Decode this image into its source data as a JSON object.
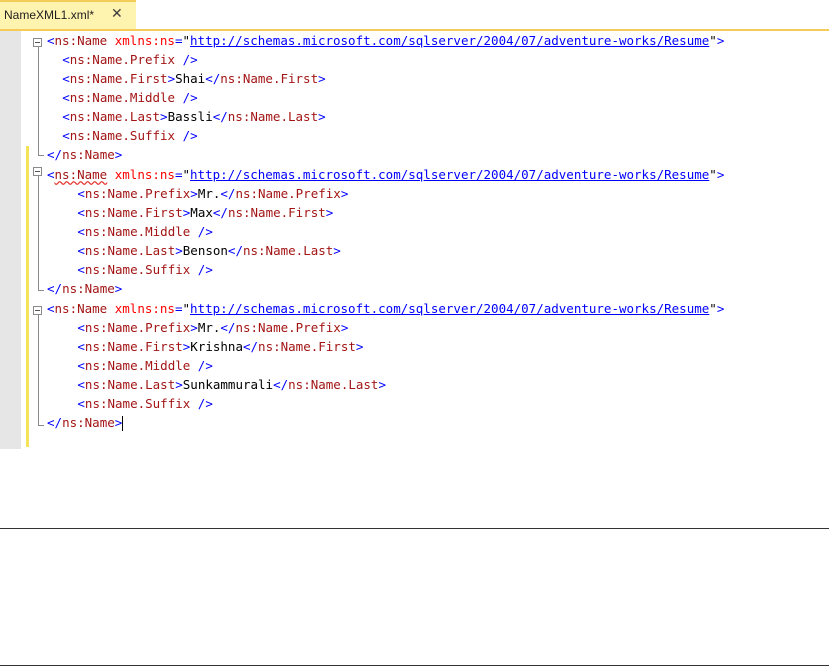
{
  "tab": {
    "title": "NameXML1.xml*",
    "close_glyph": "✕"
  },
  "lines": [
    {
      "indent": 0,
      "parts": [
        [
          "d",
          "<"
        ],
        [
          "t",
          "ns:Name"
        ],
        [
          "a",
          " xmlns:ns"
        ],
        [
          "d",
          "="
        ],
        [
          "q",
          "\""
        ],
        [
          "u",
          "http://schemas.microsoft.com/sqlserver/2004/07/adventure-works/Resume"
        ],
        [
          "q",
          "\""
        ],
        [
          "d",
          ">"
        ]
      ]
    },
    {
      "indent": 2,
      "parts": [
        [
          "d",
          "<"
        ],
        [
          "t",
          "ns:Name.Prefix"
        ],
        [
          "d",
          " />"
        ]
      ]
    },
    {
      "indent": 2,
      "parts": [
        [
          "d",
          "<"
        ],
        [
          "t",
          "ns:Name.First"
        ],
        [
          "d",
          ">"
        ],
        [
          "x",
          "Shai"
        ],
        [
          "d",
          "</"
        ],
        [
          "t",
          "ns:Name.First"
        ],
        [
          "d",
          ">"
        ]
      ]
    },
    {
      "indent": 2,
      "parts": [
        [
          "d",
          "<"
        ],
        [
          "t",
          "ns:Name.Middle"
        ],
        [
          "d",
          " />"
        ]
      ]
    },
    {
      "indent": 2,
      "parts": [
        [
          "d",
          "<"
        ],
        [
          "t",
          "ns:Name.Last"
        ],
        [
          "d",
          ">"
        ],
        [
          "x",
          "Bassli"
        ],
        [
          "d",
          "</"
        ],
        [
          "t",
          "ns:Name.Last"
        ],
        [
          "d",
          ">"
        ]
      ]
    },
    {
      "indent": 2,
      "parts": [
        [
          "d",
          "<"
        ],
        [
          "t",
          "ns:Name.Suffix"
        ],
        [
          "d",
          " />"
        ]
      ]
    },
    {
      "indent": 0,
      "parts": [
        [
          "d",
          "</"
        ],
        [
          "t",
          "ns:Name"
        ],
        [
          "d",
          ">"
        ]
      ]
    },
    {
      "indent": 0,
      "parts": [
        [
          "d",
          "<"
        ],
        [
          "s",
          "ns:Name"
        ],
        [
          "a",
          " xmlns:ns"
        ],
        [
          "d",
          "="
        ],
        [
          "q",
          "\""
        ],
        [
          "u",
          "http://schemas.microsoft.com/sqlserver/2004/07/adventure-works/Resume"
        ],
        [
          "q",
          "\""
        ],
        [
          "d",
          ">"
        ]
      ]
    },
    {
      "indent": 4,
      "parts": [
        [
          "d",
          "<"
        ],
        [
          "t",
          "ns:Name.Prefix"
        ],
        [
          "d",
          ">"
        ],
        [
          "x",
          "Mr."
        ],
        [
          "d",
          "</"
        ],
        [
          "t",
          "ns:Name.Prefix"
        ],
        [
          "d",
          ">"
        ]
      ]
    },
    {
      "indent": 4,
      "parts": [
        [
          "d",
          "<"
        ],
        [
          "t",
          "ns:Name.First"
        ],
        [
          "d",
          ">"
        ],
        [
          "x",
          "Max"
        ],
        [
          "d",
          "</"
        ],
        [
          "t",
          "ns:Name.First"
        ],
        [
          "d",
          ">"
        ]
      ]
    },
    {
      "indent": 4,
      "parts": [
        [
          "d",
          "<"
        ],
        [
          "t",
          "ns:Name.Middle"
        ],
        [
          "d",
          " />"
        ]
      ]
    },
    {
      "indent": 4,
      "parts": [
        [
          "d",
          "<"
        ],
        [
          "t",
          "ns:Name.Last"
        ],
        [
          "d",
          ">"
        ],
        [
          "x",
          "Benson"
        ],
        [
          "d",
          "</"
        ],
        [
          "t",
          "ns:Name.Last"
        ],
        [
          "d",
          ">"
        ]
      ]
    },
    {
      "indent": 4,
      "parts": [
        [
          "d",
          "<"
        ],
        [
          "t",
          "ns:Name.Suffix"
        ],
        [
          "d",
          " />"
        ]
      ]
    },
    {
      "indent": 0,
      "parts": [
        [
          "d",
          "</"
        ],
        [
          "t",
          "ns:Name"
        ],
        [
          "d",
          ">"
        ]
      ]
    },
    {
      "indent": 0,
      "parts": [
        [
          "d",
          "<"
        ],
        [
          "t",
          "ns:Name"
        ],
        [
          "a",
          " xmlns:ns"
        ],
        [
          "d",
          "="
        ],
        [
          "q",
          "\""
        ],
        [
          "u",
          "http://schemas.microsoft.com/sqlserver/2004/07/adventure-works/Resume"
        ],
        [
          "q",
          "\""
        ],
        [
          "d",
          ">"
        ]
      ]
    },
    {
      "indent": 4,
      "parts": [
        [
          "d",
          "<"
        ],
        [
          "t",
          "ns:Name.Prefix"
        ],
        [
          "d",
          ">"
        ],
        [
          "x",
          "Mr."
        ],
        [
          "d",
          "</"
        ],
        [
          "t",
          "ns:Name.Prefix"
        ],
        [
          "d",
          ">"
        ]
      ]
    },
    {
      "indent": 4,
      "parts": [
        [
          "d",
          "<"
        ],
        [
          "t",
          "ns:Name.First"
        ],
        [
          "d",
          ">"
        ],
        [
          "x",
          "Krishna"
        ],
        [
          "d",
          "</"
        ],
        [
          "t",
          "ns:Name.First"
        ],
        [
          "d",
          ">"
        ]
      ]
    },
    {
      "indent": 4,
      "parts": [
        [
          "d",
          "<"
        ],
        [
          "t",
          "ns:Name.Middle"
        ],
        [
          "d",
          " />"
        ]
      ]
    },
    {
      "indent": 4,
      "parts": [
        [
          "d",
          "<"
        ],
        [
          "t",
          "ns:Name.Last"
        ],
        [
          "d",
          ">"
        ],
        [
          "x",
          "Sunkammurali"
        ],
        [
          "d",
          "</"
        ],
        [
          "t",
          "ns:Name.Last"
        ],
        [
          "d",
          ">"
        ]
      ]
    },
    {
      "indent": 4,
      "parts": [
        [
          "d",
          "<"
        ],
        [
          "t",
          "ns:Name.Suffix"
        ],
        [
          "d",
          " />"
        ]
      ]
    },
    {
      "indent": 0,
      "caret": true,
      "parts": [
        [
          "d",
          "</"
        ],
        [
          "t",
          "ns:Name"
        ],
        [
          "d",
          ">"
        ]
      ]
    }
  ]
}
